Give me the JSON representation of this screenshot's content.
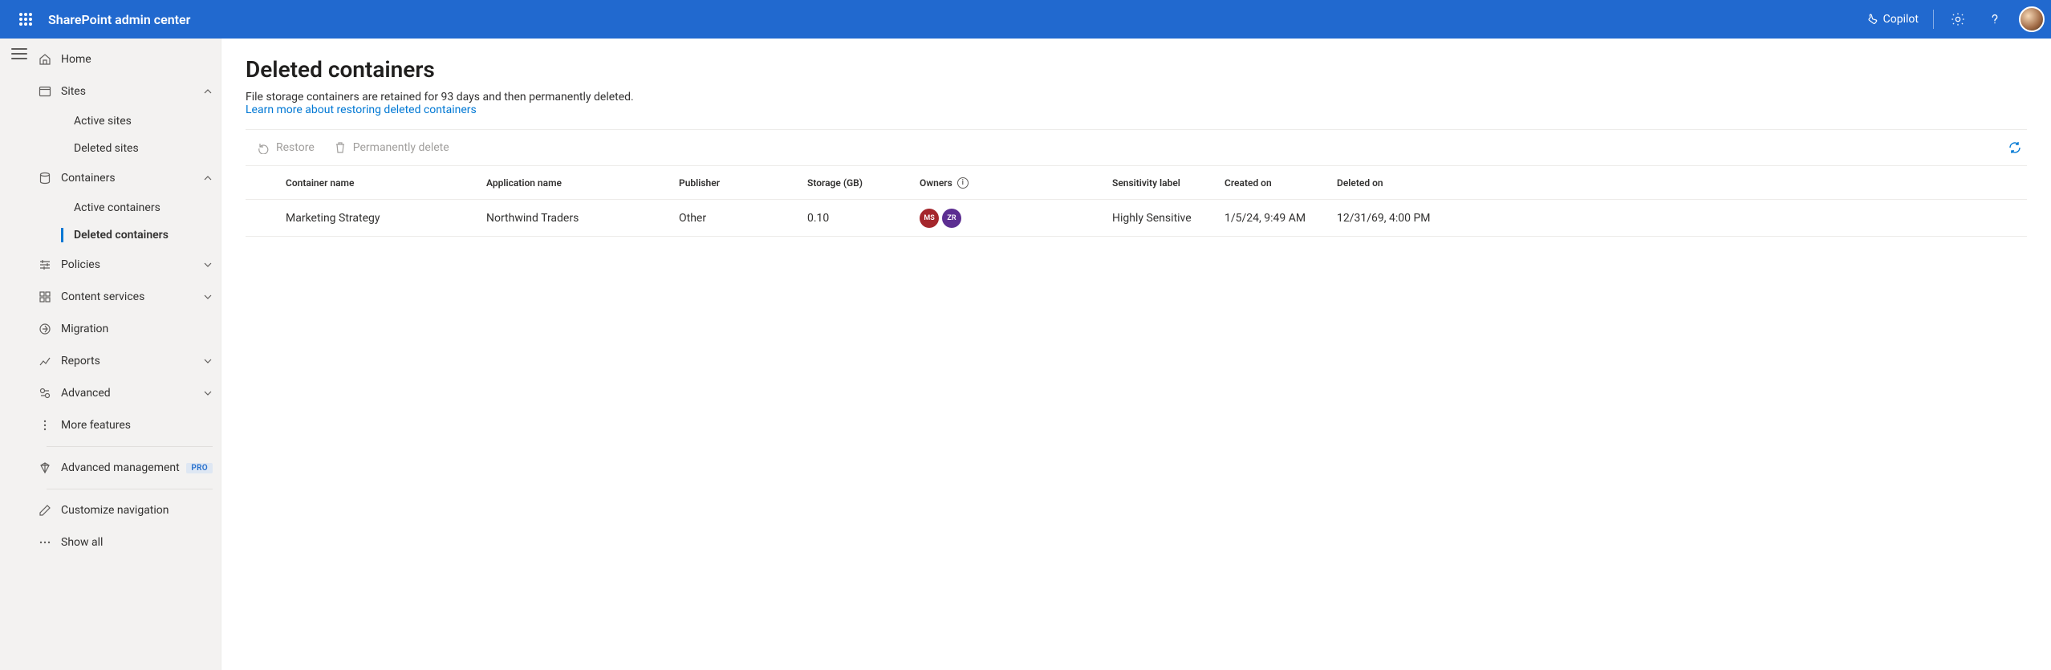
{
  "header": {
    "title": "SharePoint admin center",
    "copilot": "Copilot"
  },
  "sidebar": {
    "home": "Home",
    "sites": {
      "label": "Sites",
      "children": [
        "Active sites",
        "Deleted sites"
      ]
    },
    "containers": {
      "label": "Containers",
      "children": [
        "Active containers",
        "Deleted containers"
      ]
    },
    "policies": "Policies",
    "content_services": "Content services",
    "migration": "Migration",
    "reports": "Reports",
    "advanced": "Advanced",
    "more_features": "More features",
    "advanced_management": "Advanced management",
    "pro_badge": "PRO",
    "customize_nav": "Customize navigation",
    "show_all": "Show all"
  },
  "page": {
    "title": "Deleted containers",
    "description": "File storage containers are retained for 93 days and then permanently deleted.",
    "learn_more": "Learn more about restoring deleted containers"
  },
  "toolbar": {
    "restore": "Restore",
    "permanently_delete": "Permanently delete"
  },
  "columns": {
    "container_name": "Container name",
    "application_name": "Application name",
    "publisher": "Publisher",
    "storage": "Storage (GB)",
    "owners": "Owners",
    "sensitivity": "Sensitivity label",
    "created": "Created on",
    "deleted": "Deleted on"
  },
  "rows": [
    {
      "container_name": "Marketing Strategy",
      "application_name": "Northwind Traders",
      "publisher": "Other",
      "storage": "0.10",
      "owners": [
        "MS",
        "ZR"
      ],
      "owner_colors": [
        "ob-red",
        "ob-purple"
      ],
      "sensitivity": "Highly Sensitive",
      "created": "1/5/24, 9:49 AM",
      "deleted": "12/31/69, 4:00 PM"
    }
  ]
}
